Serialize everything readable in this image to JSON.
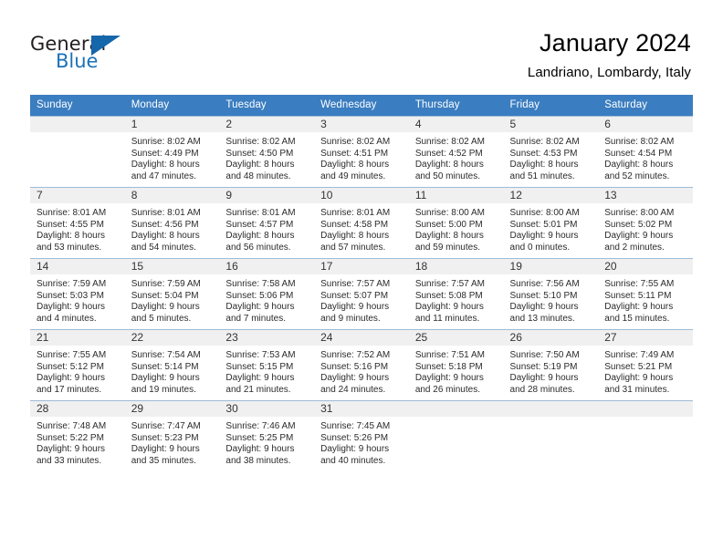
{
  "logo": {
    "word_dark": "General",
    "word_blue": "Blue",
    "triangle_color": "#1566ab",
    "blue_color": "#1b72b8"
  },
  "header": {
    "title": "January 2024",
    "subtitle": "Landriano, Lombardy, Italy",
    "header_bg": "#3a7dc0",
    "daynum_bg": "#f0f0f0",
    "grid_line": "#9dbcd8"
  },
  "weekday_headers": [
    "Sunday",
    "Monday",
    "Tuesday",
    "Wednesday",
    "Thursday",
    "Friday",
    "Saturday"
  ],
  "weeks": [
    [
      {
        "day": "",
        "empty": true,
        "sunrise": "",
        "sunset": "",
        "daylight_1": "",
        "daylight_2": ""
      },
      {
        "day": "1",
        "sunrise": "Sunrise: 8:02 AM",
        "sunset": "Sunset: 4:49 PM",
        "daylight_1": "Daylight: 8 hours",
        "daylight_2": "and 47 minutes."
      },
      {
        "day": "2",
        "sunrise": "Sunrise: 8:02 AM",
        "sunset": "Sunset: 4:50 PM",
        "daylight_1": "Daylight: 8 hours",
        "daylight_2": "and 48 minutes."
      },
      {
        "day": "3",
        "sunrise": "Sunrise: 8:02 AM",
        "sunset": "Sunset: 4:51 PM",
        "daylight_1": "Daylight: 8 hours",
        "daylight_2": "and 49 minutes."
      },
      {
        "day": "4",
        "sunrise": "Sunrise: 8:02 AM",
        "sunset": "Sunset: 4:52 PM",
        "daylight_1": "Daylight: 8 hours",
        "daylight_2": "and 50 minutes."
      },
      {
        "day": "5",
        "sunrise": "Sunrise: 8:02 AM",
        "sunset": "Sunset: 4:53 PM",
        "daylight_1": "Daylight: 8 hours",
        "daylight_2": "and 51 minutes."
      },
      {
        "day": "6",
        "sunrise": "Sunrise: 8:02 AM",
        "sunset": "Sunset: 4:54 PM",
        "daylight_1": "Daylight: 8 hours",
        "daylight_2": "and 52 minutes."
      }
    ],
    [
      {
        "day": "7",
        "sunrise": "Sunrise: 8:01 AM",
        "sunset": "Sunset: 4:55 PM",
        "daylight_1": "Daylight: 8 hours",
        "daylight_2": "and 53 minutes."
      },
      {
        "day": "8",
        "sunrise": "Sunrise: 8:01 AM",
        "sunset": "Sunset: 4:56 PM",
        "daylight_1": "Daylight: 8 hours",
        "daylight_2": "and 54 minutes."
      },
      {
        "day": "9",
        "sunrise": "Sunrise: 8:01 AM",
        "sunset": "Sunset: 4:57 PM",
        "daylight_1": "Daylight: 8 hours",
        "daylight_2": "and 56 minutes."
      },
      {
        "day": "10",
        "sunrise": "Sunrise: 8:01 AM",
        "sunset": "Sunset: 4:58 PM",
        "daylight_1": "Daylight: 8 hours",
        "daylight_2": "and 57 minutes."
      },
      {
        "day": "11",
        "sunrise": "Sunrise: 8:00 AM",
        "sunset": "Sunset: 5:00 PM",
        "daylight_1": "Daylight: 8 hours",
        "daylight_2": "and 59 minutes."
      },
      {
        "day": "12",
        "sunrise": "Sunrise: 8:00 AM",
        "sunset": "Sunset: 5:01 PM",
        "daylight_1": "Daylight: 9 hours",
        "daylight_2": "and 0 minutes."
      },
      {
        "day": "13",
        "sunrise": "Sunrise: 8:00 AM",
        "sunset": "Sunset: 5:02 PM",
        "daylight_1": "Daylight: 9 hours",
        "daylight_2": "and 2 minutes."
      }
    ],
    [
      {
        "day": "14",
        "sunrise": "Sunrise: 7:59 AM",
        "sunset": "Sunset: 5:03 PM",
        "daylight_1": "Daylight: 9 hours",
        "daylight_2": "and 4 minutes."
      },
      {
        "day": "15",
        "sunrise": "Sunrise: 7:59 AM",
        "sunset": "Sunset: 5:04 PM",
        "daylight_1": "Daylight: 9 hours",
        "daylight_2": "and 5 minutes."
      },
      {
        "day": "16",
        "sunrise": "Sunrise: 7:58 AM",
        "sunset": "Sunset: 5:06 PM",
        "daylight_1": "Daylight: 9 hours",
        "daylight_2": "and 7 minutes."
      },
      {
        "day": "17",
        "sunrise": "Sunrise: 7:57 AM",
        "sunset": "Sunset: 5:07 PM",
        "daylight_1": "Daylight: 9 hours",
        "daylight_2": "and 9 minutes."
      },
      {
        "day": "18",
        "sunrise": "Sunrise: 7:57 AM",
        "sunset": "Sunset: 5:08 PM",
        "daylight_1": "Daylight: 9 hours",
        "daylight_2": "and 11 minutes."
      },
      {
        "day": "19",
        "sunrise": "Sunrise: 7:56 AM",
        "sunset": "Sunset: 5:10 PM",
        "daylight_1": "Daylight: 9 hours",
        "daylight_2": "and 13 minutes."
      },
      {
        "day": "20",
        "sunrise": "Sunrise: 7:55 AM",
        "sunset": "Sunset: 5:11 PM",
        "daylight_1": "Daylight: 9 hours",
        "daylight_2": "and 15 minutes."
      }
    ],
    [
      {
        "day": "21",
        "sunrise": "Sunrise: 7:55 AM",
        "sunset": "Sunset: 5:12 PM",
        "daylight_1": "Daylight: 9 hours",
        "daylight_2": "and 17 minutes."
      },
      {
        "day": "22",
        "sunrise": "Sunrise: 7:54 AM",
        "sunset": "Sunset: 5:14 PM",
        "daylight_1": "Daylight: 9 hours",
        "daylight_2": "and 19 minutes."
      },
      {
        "day": "23",
        "sunrise": "Sunrise: 7:53 AM",
        "sunset": "Sunset: 5:15 PM",
        "daylight_1": "Daylight: 9 hours",
        "daylight_2": "and 21 minutes."
      },
      {
        "day": "24",
        "sunrise": "Sunrise: 7:52 AM",
        "sunset": "Sunset: 5:16 PM",
        "daylight_1": "Daylight: 9 hours",
        "daylight_2": "and 24 minutes."
      },
      {
        "day": "25",
        "sunrise": "Sunrise: 7:51 AM",
        "sunset": "Sunset: 5:18 PM",
        "daylight_1": "Daylight: 9 hours",
        "daylight_2": "and 26 minutes."
      },
      {
        "day": "26",
        "sunrise": "Sunrise: 7:50 AM",
        "sunset": "Sunset: 5:19 PM",
        "daylight_1": "Daylight: 9 hours",
        "daylight_2": "and 28 minutes."
      },
      {
        "day": "27",
        "sunrise": "Sunrise: 7:49 AM",
        "sunset": "Sunset: 5:21 PM",
        "daylight_1": "Daylight: 9 hours",
        "daylight_2": "and 31 minutes."
      }
    ],
    [
      {
        "day": "28",
        "sunrise": "Sunrise: 7:48 AM",
        "sunset": "Sunset: 5:22 PM",
        "daylight_1": "Daylight: 9 hours",
        "daylight_2": "and 33 minutes."
      },
      {
        "day": "29",
        "sunrise": "Sunrise: 7:47 AM",
        "sunset": "Sunset: 5:23 PM",
        "daylight_1": "Daylight: 9 hours",
        "daylight_2": "and 35 minutes."
      },
      {
        "day": "30",
        "sunrise": "Sunrise: 7:46 AM",
        "sunset": "Sunset: 5:25 PM",
        "daylight_1": "Daylight: 9 hours",
        "daylight_2": "and 38 minutes."
      },
      {
        "day": "31",
        "sunrise": "Sunrise: 7:45 AM",
        "sunset": "Sunset: 5:26 PM",
        "daylight_1": "Daylight: 9 hours",
        "daylight_2": "and 40 minutes."
      },
      {
        "day": "",
        "empty": true,
        "sunrise": "",
        "sunset": "",
        "daylight_1": "",
        "daylight_2": ""
      },
      {
        "day": "",
        "empty": true,
        "sunrise": "",
        "sunset": "",
        "daylight_1": "",
        "daylight_2": ""
      },
      {
        "day": "",
        "empty": true,
        "sunrise": "",
        "sunset": "",
        "daylight_1": "",
        "daylight_2": ""
      }
    ]
  ]
}
